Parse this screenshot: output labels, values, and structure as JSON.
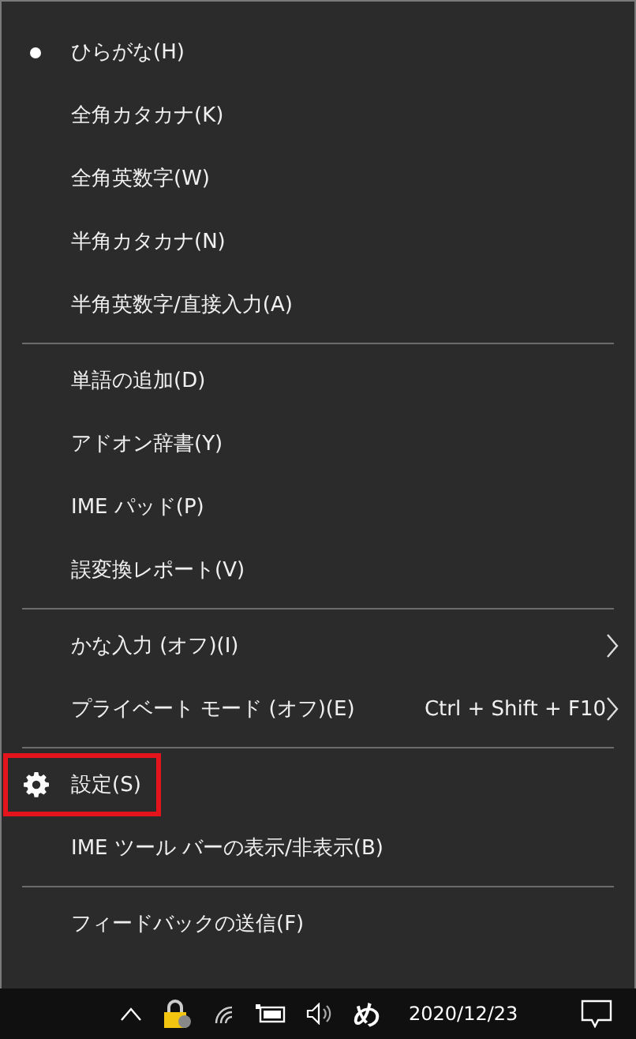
{
  "menu": {
    "groups": [
      {
        "items": [
          {
            "kind": "radio",
            "label": "ひらがな(H)",
            "selected": true,
            "highlighted": false
          },
          {
            "kind": "radio",
            "label": "全角カタカナ(K)",
            "selected": false,
            "highlighted": false
          },
          {
            "kind": "radio",
            "label": "全角英数字(W)",
            "selected": false,
            "highlighted": false
          },
          {
            "kind": "radio",
            "label": "半角カタカナ(N)",
            "selected": false,
            "highlighted": false
          },
          {
            "kind": "radio",
            "label": "半角英数字/直接入力(A)",
            "selected": false,
            "highlighted": false
          }
        ]
      },
      {
        "items": [
          {
            "kind": "plain",
            "label": "単語の追加(D)",
            "highlighted": false
          },
          {
            "kind": "plain",
            "label": "アドオン辞書(Y)",
            "highlighted": false
          },
          {
            "kind": "plain",
            "label": "IME パッド(P)",
            "highlighted": false
          },
          {
            "kind": "plain",
            "label": "誤変換レポート(V)",
            "highlighted": false
          }
        ]
      },
      {
        "items": [
          {
            "kind": "submenu",
            "label": "かな入力 (オフ)(I)",
            "highlighted": false
          },
          {
            "kind": "submenu",
            "label": "プライベート モード (オフ)(E)",
            "shortcut": "Ctrl + Shift + F10",
            "highlighted": false
          }
        ]
      },
      {
        "items": [
          {
            "kind": "settings",
            "label": "設定(S)",
            "highlighted": true
          },
          {
            "kind": "plain",
            "label": "IME ツール バーの表示/非表示(B)",
            "highlighted": false
          }
        ]
      },
      {
        "items": [
          {
            "kind": "plain",
            "label": "フィードバックの送信(F)",
            "highlighted": false
          }
        ]
      }
    ]
  },
  "taskbar": {
    "ime_indicator": "め",
    "date": "2020/12/23"
  }
}
